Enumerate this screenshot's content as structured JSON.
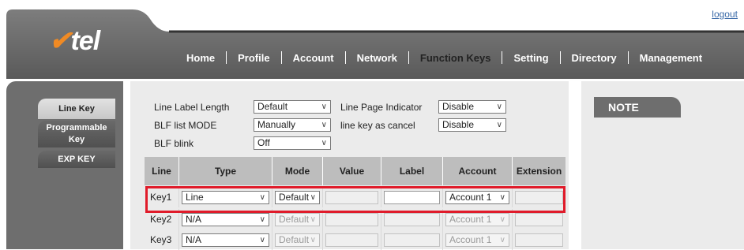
{
  "header": {
    "logo_brand": "Axtel",
    "logo_text": "tel",
    "logout": "logout",
    "nav": [
      "Home",
      "Profile",
      "Account",
      "Network",
      "Function Keys",
      "Setting",
      "Directory",
      "Management"
    ],
    "active_nav": "Function Keys"
  },
  "sidebar": {
    "items": [
      "Line Key",
      "Programmable Key",
      "EXP KEY"
    ]
  },
  "settings": {
    "line_label_length": {
      "label": "Line Label Length",
      "value": "Default"
    },
    "line_page_indicator": {
      "label": "Line Page Indicator",
      "value": "Disable"
    },
    "blf_list_mode": {
      "label": "BLF list MODE",
      "value": "Manually"
    },
    "line_key_as_cancel": {
      "label": "line key as cancel",
      "value": "Disable"
    },
    "blf_blink": {
      "label": "BLF blink",
      "value": "Off"
    }
  },
  "table": {
    "headers": [
      "Line",
      "Type",
      "Mode",
      "Value",
      "Label",
      "Account",
      "Extension"
    ],
    "rows": [
      {
        "line": "Key1",
        "type": "Line",
        "mode": "Default",
        "value": "",
        "label": "",
        "account": "Account 1",
        "extension": ""
      },
      {
        "line": "Key2",
        "type": "N/A",
        "mode": "Default",
        "value": "",
        "label": "",
        "account": "Account 1",
        "extension": ""
      },
      {
        "line": "Key3",
        "type": "N/A",
        "mode": "Default",
        "value": "",
        "label": "",
        "account": "Account 1",
        "extension": ""
      }
    ]
  },
  "note": {
    "title": "NOTE"
  },
  "colors": {
    "accent_orange": "#f08a24",
    "highlight_red": "#e01b2a",
    "header_gray": "#6e6e6e",
    "panel_gray": "#ebebeb"
  }
}
